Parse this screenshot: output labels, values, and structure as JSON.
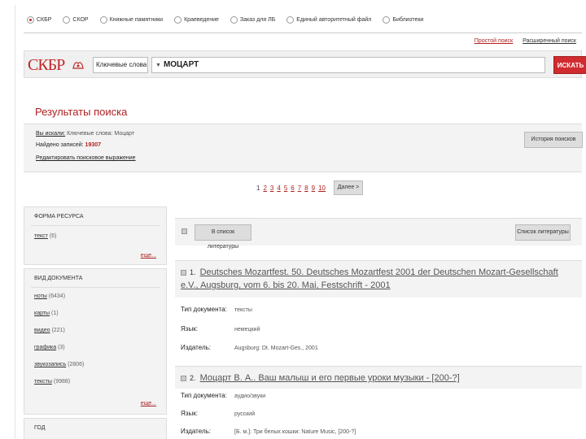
{
  "colors": {
    "brand": "#c0262a",
    "accent": "#d02b2f",
    "panel": "#f3f3f3"
  },
  "top_radios": [
    {
      "label": "СКБР",
      "selected": true
    },
    {
      "label": "СКОР",
      "selected": false
    },
    {
      "label": "Книжные памятники",
      "selected": false
    },
    {
      "label": "Краеведение",
      "selected": false
    },
    {
      "label": "Заказ для ЛБ",
      "selected": false
    },
    {
      "label": "Единый авторитетный файл",
      "selected": false
    },
    {
      "label": "Библиотеки",
      "selected": false
    }
  ],
  "search_links": {
    "simple": "Простой поиск",
    "advanced": "Расширенный поиск"
  },
  "searchbar": {
    "logo": "СКБР",
    "field": "Ключевые слова",
    "query": "МОЦАРТ",
    "button": "ИСКАТЬ"
  },
  "results_title": "Результаты поиска",
  "summary": {
    "searched_label": "Вы искали:",
    "searched_value": "Ключевые слова: Моцарт",
    "found_label": "Найдено записей:",
    "found_value": "19307",
    "edit_label": "Редактировать поисковое выражение",
    "history_button": "История поисков"
  },
  "pager": {
    "pages": [
      "1",
      "2",
      "3",
      "4",
      "5",
      "6",
      "7",
      "8",
      "9",
      "10"
    ],
    "current": "1",
    "next": "Далее >"
  },
  "facets": [
    {
      "title": "ФОРМА РЕСУРСА",
      "items": [
        {
          "key": "текст",
          "count": "(6)"
        }
      ],
      "more": "еще..."
    },
    {
      "title": "ВИД ДОКУМЕНТА",
      "items": [
        {
          "key": "ноты",
          "count": "(6434)"
        },
        {
          "key": "карты",
          "count": "(1)"
        },
        {
          "key": "видео",
          "count": "(221)"
        },
        {
          "key": "графика",
          "count": "(3)"
        },
        {
          "key": "звукозапись",
          "count": "(2806)"
        },
        {
          "key": "тексты",
          "count": "(9988)"
        }
      ],
      "more": "еще..."
    },
    {
      "title": "ГОД",
      "items": [],
      "more": ""
    }
  ],
  "list_toolbar": {
    "add_button": "В список литературы",
    "list_button": "Список литературы"
  },
  "records": [
    {
      "num": "1.",
      "title": "Deutsches Mozartfest. 50. Deutsches Mozartfest 2001 der Deutschen Mozart-Gesellschaft e.V., Augsburg, vom 6. bis 20. Mai, Festschrift - 2001",
      "fields": [
        {
          "label": "Тип документа:",
          "value": "тексты"
        },
        {
          "label": "Язык:",
          "value": "немецкий"
        },
        {
          "label": "Издатель:",
          "value": "Augsburg: Dt. Mozart-Ges., 2001"
        }
      ]
    },
    {
      "num": "2.",
      "title": "Моцарт В. А.. Ваш малыш и его первые уроки музыки - [200-?]",
      "fields": [
        {
          "label": "Тип документа:",
          "value": "аудио/звуки"
        },
        {
          "label": "Язык:",
          "value": "русский"
        },
        {
          "label": "Издатель:",
          "value": "[Б. м.]: Три белых кошки: Nature Music, [200-?]"
        }
      ]
    }
  ]
}
